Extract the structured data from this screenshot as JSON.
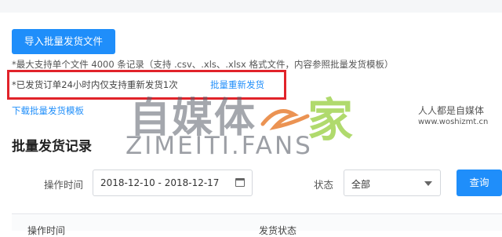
{
  "upload": {
    "import_button": "导入批量发货文件",
    "hint_limit": "*最大支持单个文件 4000 条记录（支持 .csv、.xls、.xlsx 格式文件，内容参照批量发货模板）",
    "hint_resend": "*已发货订单24小时内仅支持重新发货1次",
    "resend_link": "批量重新发货",
    "download_template": "下载批量发货模板"
  },
  "records": {
    "title": "批量发货记录",
    "filters": {
      "time_label": "操作时间",
      "date_range": "2018-12-10 - 2018-12-17",
      "status_label": "状态",
      "status_value": "全部",
      "query_button": "查询"
    },
    "table_headers": [
      "操作时间",
      "发货状态"
    ]
  },
  "watermark": {
    "logo_text_a": "自媒体",
    "logo_text_b": "家",
    "logo_fans": "ZIMEITI.FANS",
    "site_cn": "人人都是自媒体",
    "site_url": "www.woshizmt.cn"
  },
  "colors": {
    "primary": "#1f8efa",
    "highlight_border": "#e1232a"
  }
}
